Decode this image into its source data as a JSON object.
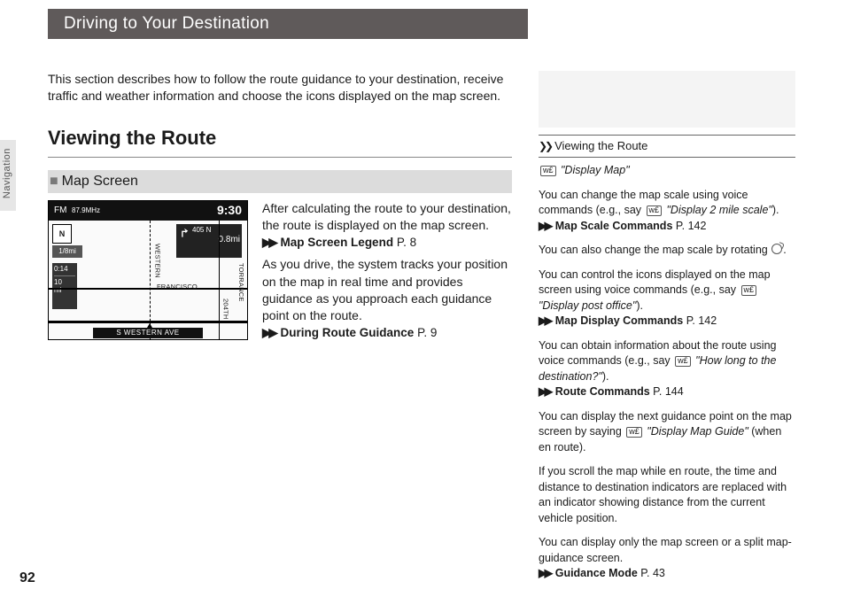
{
  "page_number": "92",
  "side_tab": "Navigation",
  "title": "Driving to Your Destination",
  "intro": "This section describes how to follow the route guidance to your destination, receive traffic and weather information and choose the icons displayed on the map screen.",
  "h2": "Viewing the Route",
  "h3": "Map Screen",
  "map": {
    "radio": "FM",
    "freq": "87.9MHz",
    "clock": "9:30",
    "compass": "N",
    "scale": "1/8mi",
    "eta_time": "0:14",
    "eta_dist": "10",
    "eta_unit": "mi",
    "turn_hwy": "405 N",
    "turn_dist": "0.8mi",
    "label_western": "WESTERN",
    "label_francisco": "FRANCISCO",
    "label_204th": "204TH",
    "label_torrance": "TORRANCE",
    "street": "S WESTERN AVE"
  },
  "body1": "After calculating the route to your destination, the route is displayed on the map screen.",
  "ref1_label": "Map Screen Legend",
  "ref1_page": "P. 8",
  "body2": "As you drive, the system tracks your position on the map in real time and provides guidance as you approach each guidance point on the route.",
  "ref2_label": "During Route Guidance",
  "ref2_page": "P. 9",
  "aside": {
    "heading": "Viewing the Route",
    "vc_glyph": "w£",
    "cmd_display_map": "\"Display Map\"",
    "p1a": "You can change the map scale using voice commands (e.g., say ",
    "cmd_scale": "\"Display 2 mile scale\"",
    "p1b": ").",
    "ref_scale_label": "Map Scale Commands",
    "ref_scale_page": "P. 142",
    "p_dial": "You can also change the map scale by rotating ",
    "p2a": "You can control the icons displayed on the map screen using voice commands (e.g., say ",
    "cmd_post": "\"Display post office\"",
    "p2b": ").",
    "ref_display_label": "Map Display Commands",
    "ref_display_page": "P. 142",
    "p3a": "You can obtain information about the route using voice commands (e.g., say ",
    "cmd_howlong": "\"How long to the destination?\"",
    "p3b": ").",
    "ref_route_label": "Route Commands",
    "ref_route_page": "P. 144",
    "p4a": "You can display the next guidance point on the map screen by saying ",
    "cmd_guide": "\"Display Map Guide\"",
    "p4b": " (when en route).",
    "p5": "If you scroll the map while en route, the time and distance to destination indicators are replaced with an indicator showing distance from the current vehicle position.",
    "p6": "You can display only the map screen or a split map-guidance screen.",
    "ref_mode_label": "Guidance Mode",
    "ref_mode_page": "P. 43"
  }
}
